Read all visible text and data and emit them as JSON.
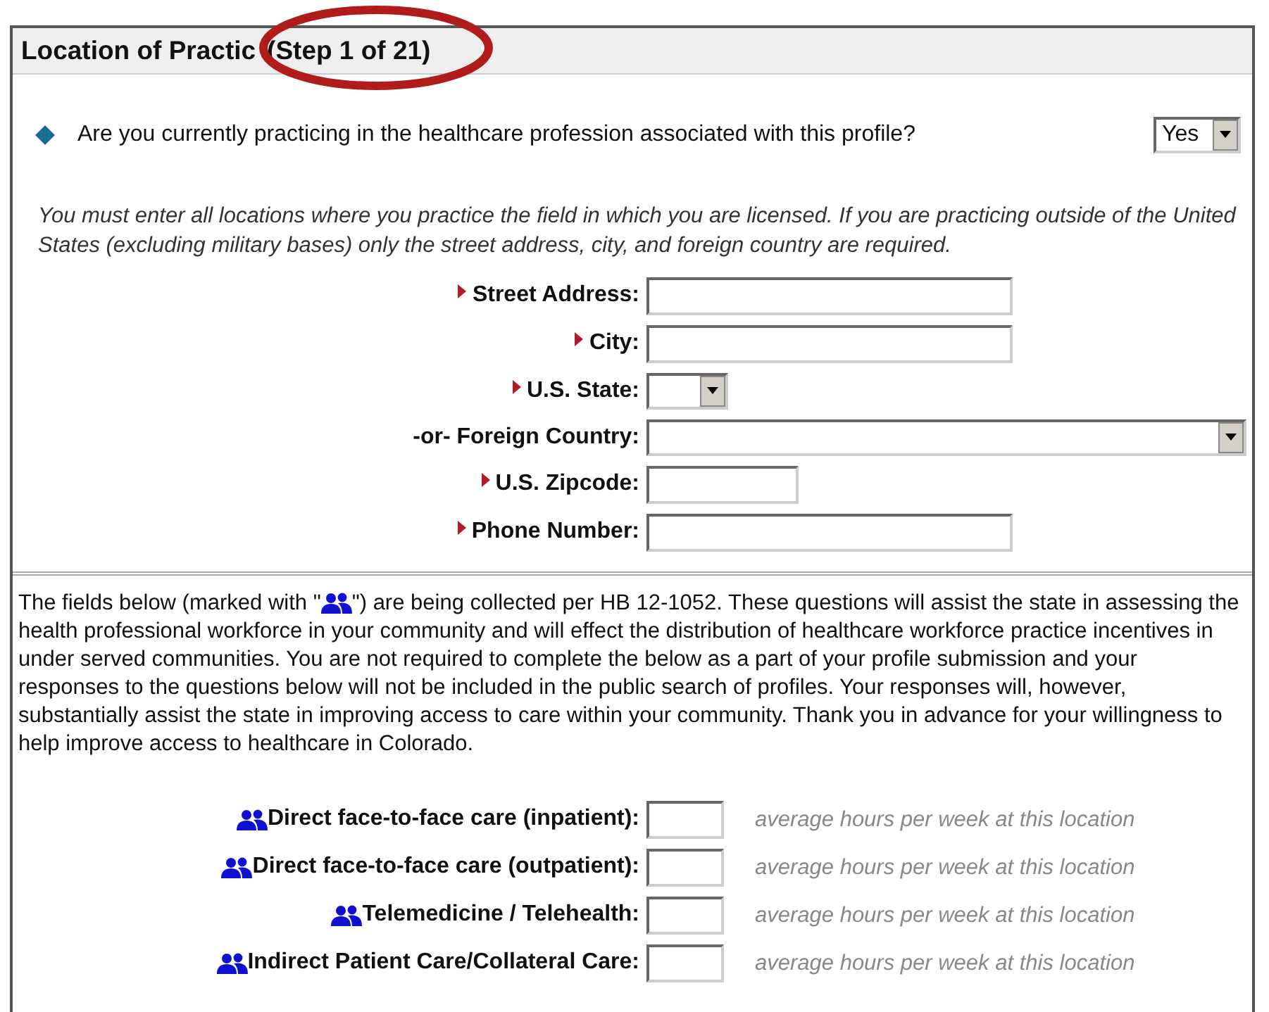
{
  "section": {
    "title": "Location of Practic",
    "step": "(Step 1 of 21)"
  },
  "question": {
    "text": "Are you currently practicing in the healthcare profession associated with this profile?",
    "answer": "Yes"
  },
  "instructions": "You must enter all locations where you practice the field in which you are licensed. If you are practicing outside of the United States (excluding military bases) only the street address, city, and foreign country are required.",
  "address_fields": [
    {
      "label": "Street Address:",
      "kind": "text",
      "required": true
    },
    {
      "label": "City:",
      "kind": "text",
      "required": true
    },
    {
      "label": "U.S. State:",
      "kind": "select",
      "required": true
    },
    {
      "label": "-or- Foreign Country:",
      "kind": "select",
      "required": false
    },
    {
      "label": "U.S. Zipcode:",
      "kind": "text",
      "required": true
    },
    {
      "label": "Phone Number:",
      "kind": "text",
      "required": true
    }
  ],
  "notice": {
    "before_icon": "The fields below (marked with \"",
    "after_icon": "\") are being collected per HB 12-1052. These questions will assist the state in assessing the health professional workforce in your community and will effect the distribution of healthcare workforce practice incentives in under served communities. You are not required to complete the below as a part of your profile submission and your responses to the questions below will not be included in the public search of profiles. Your responses will, however, substantially assist the state in improving access to care within your community. Thank you in advance for your willingness to help improve access to healthcare in Colorado."
  },
  "hours_fields": [
    {
      "label": "Direct face-to-face care (inpatient):",
      "hint": "average hours per week at this location"
    },
    {
      "label": "Direct face-to-face care (outpatient):",
      "hint": "average hours per week at this location"
    },
    {
      "label": "Telemedicine / Telehealth:",
      "hint": "average hours per week at this location"
    },
    {
      "label": "Indirect Patient Care/Collateral Care:",
      "hint": "average hours per week at this location"
    }
  ]
}
